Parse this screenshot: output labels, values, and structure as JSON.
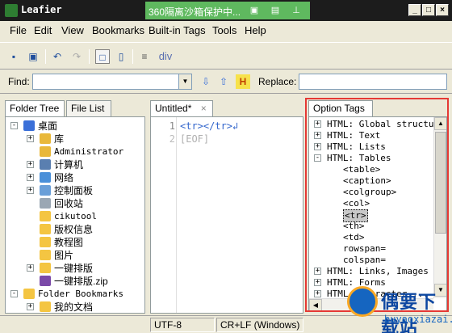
{
  "window": {
    "title": "Leafier",
    "floater_text": "360隔离沙箱保护中...",
    "minimize": "_",
    "maximize": "□",
    "close": "×"
  },
  "menu": [
    "File",
    "Edit",
    "View",
    "Bookmarks",
    "Built-in Tags",
    "Tools",
    "Help"
  ],
  "toolbar": {
    "tag_label": "div"
  },
  "findbar": {
    "find_label": "Find:",
    "find_value": "",
    "replace_label": "Replace:",
    "replace_value": ""
  },
  "left_tabs": [
    "Folder Tree",
    "File List"
  ],
  "folder_tree": [
    {
      "label": "桌面",
      "level": 0,
      "expander": "-",
      "icon": "desktop-icon"
    },
    {
      "label": "库",
      "level": 1,
      "expander": "+",
      "icon": "library-icon"
    },
    {
      "label": "Administrator",
      "level": 1,
      "expander": "",
      "icon": "user-icon",
      "mono": true
    },
    {
      "label": "计算机",
      "level": 1,
      "expander": "+",
      "icon": "computer-icon"
    },
    {
      "label": "网络",
      "level": 1,
      "expander": "+",
      "icon": "network-icon"
    },
    {
      "label": "控制面板",
      "level": 1,
      "expander": "+",
      "icon": "control-panel-icon"
    },
    {
      "label": "回收站",
      "level": 1,
      "expander": "",
      "icon": "recycle-bin-icon"
    },
    {
      "label": "cikutool",
      "level": 1,
      "expander": "",
      "icon": "folder-icon",
      "mono": true
    },
    {
      "label": "版权信息",
      "level": 1,
      "expander": "",
      "icon": "folder-icon"
    },
    {
      "label": "教程图",
      "level": 1,
      "expander": "",
      "icon": "folder-icon"
    },
    {
      "label": "图片",
      "level": 1,
      "expander": "",
      "icon": "folder-icon"
    },
    {
      "label": "一键排版",
      "level": 1,
      "expander": "+",
      "icon": "folder-icon"
    },
    {
      "label": "一键排版.zip",
      "level": 1,
      "expander": "",
      "icon": "zip-icon"
    },
    {
      "label": "Folder Bookmarks",
      "level": 0,
      "expander": "-",
      "icon": "bookmark-folder-icon",
      "mono": true
    },
    {
      "label": "我的文档",
      "level": 1,
      "expander": "+",
      "icon": "folder-icon"
    }
  ],
  "editor": {
    "tab_label": "Untitled*",
    "tab_close": "×",
    "lines": [
      {
        "num": "1",
        "text": "<tr></tr>↲",
        "eof": false
      },
      {
        "num": "2",
        "text": "[EOF]",
        "eof": true
      }
    ]
  },
  "right_tab": "Option Tags",
  "option_tags": [
    {
      "label": "HTML: Global structure",
      "level": 0,
      "expander": "+"
    },
    {
      "label": "HTML: Text",
      "level": 0,
      "expander": "+"
    },
    {
      "label": "HTML: Lists",
      "level": 0,
      "expander": "+"
    },
    {
      "label": "HTML: Tables",
      "level": 0,
      "expander": "-"
    },
    {
      "label": "<table>",
      "level": 1,
      "expander": ""
    },
    {
      "label": "<caption>",
      "level": 1,
      "expander": ""
    },
    {
      "label": "<colgroup>",
      "level": 1,
      "expander": ""
    },
    {
      "label": "<col>",
      "level": 1,
      "expander": ""
    },
    {
      "label": "<tr>",
      "level": 1,
      "expander": "",
      "selected": true
    },
    {
      "label": "<th>",
      "level": 1,
      "expander": ""
    },
    {
      "label": "<td>",
      "level": 1,
      "expander": ""
    },
    {
      "label": "rowspan=",
      "level": 1,
      "expander": ""
    },
    {
      "label": "colspan=",
      "level": 1,
      "expander": ""
    },
    {
      "label": "HTML: Links, Images",
      "level": 0,
      "expander": "+"
    },
    {
      "label": "HTML: Forms",
      "level": 0,
      "expander": "+"
    },
    {
      "label": "HTML: Character ...",
      "level": 0,
      "expander": "+"
    }
  ],
  "status": {
    "encoding": "UTF-8",
    "line_ending": "CR+LF (Windows)"
  },
  "watermark": {
    "name": "偶要下载站",
    "url": "buyaoxiazai.com"
  }
}
